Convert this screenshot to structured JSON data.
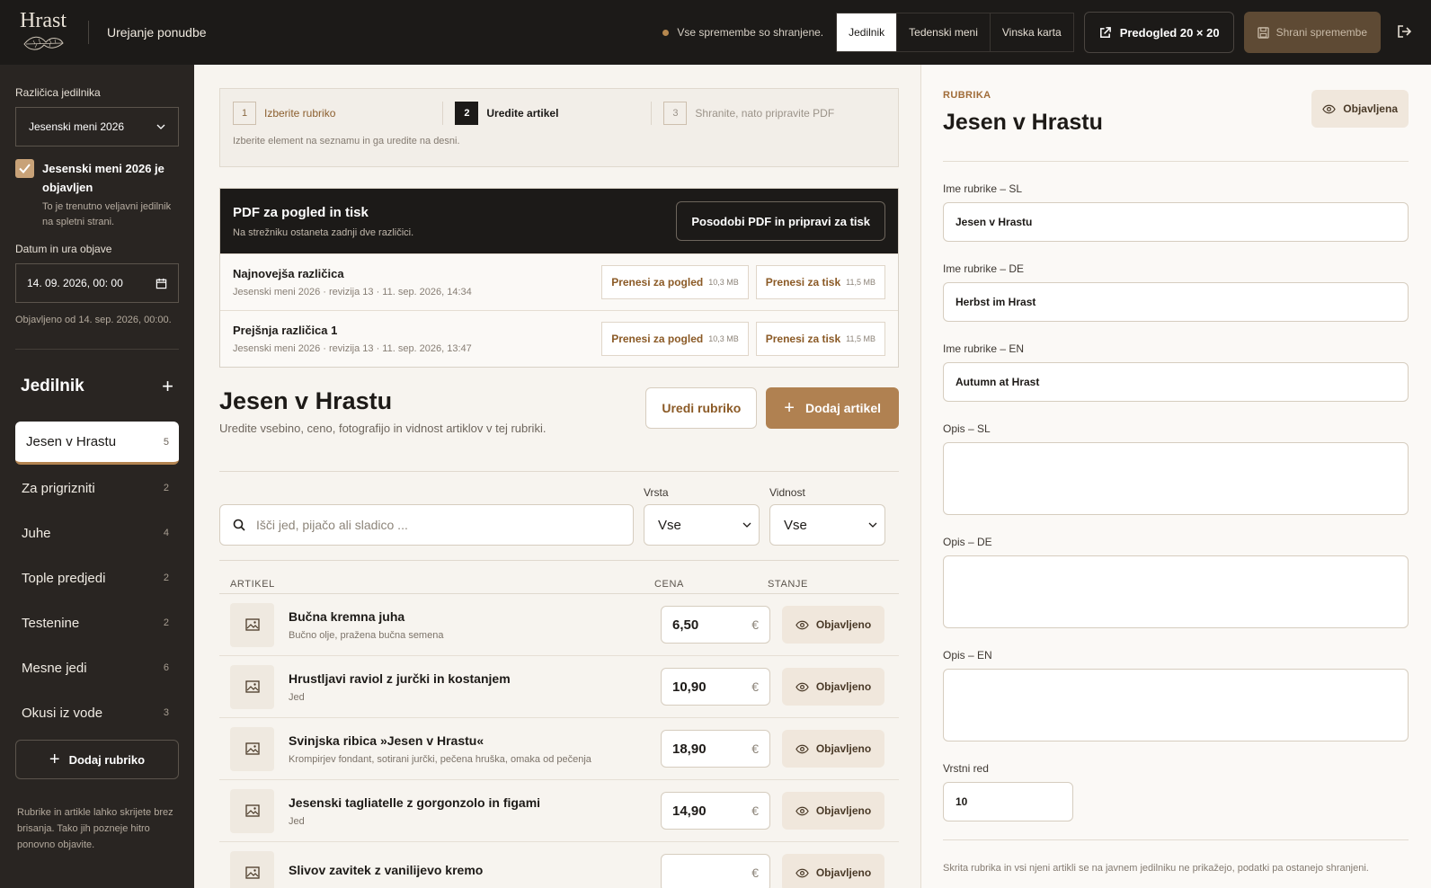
{
  "header": {
    "logo_text": "Hrast",
    "page_name": "Urejanje ponudbe",
    "saved_status": "Vse spremembe so shranjene.",
    "tabs": [
      {
        "label": "Jedilnik"
      },
      {
        "label": "Tedenski meni"
      },
      {
        "label": "Vinska karta"
      }
    ],
    "preview_label": "Predogled 20 × 20",
    "save_label": "Shrani spremembe"
  },
  "sidebar": {
    "version_label": "Različica jedilnika",
    "version_value": "Jesenski meni 2026",
    "published_title": "Jesenski meni 2026 je objavljen",
    "published_note": "To je trenutno veljavni jedilnik na spletni strani.",
    "date_label": "Datum in ura objave",
    "date_value": "14. 09. 2026, 00: 00",
    "published_since": "Objavljeno od 14. sep. 2026, 00:00.",
    "menu_title": "Jedilnik",
    "categories": [
      {
        "name": "Jesen v Hrastu",
        "count": "5"
      },
      {
        "name": "Za prigrizniti",
        "count": "2"
      },
      {
        "name": "Juhe",
        "count": "4"
      },
      {
        "name": "Tople predjedi",
        "count": "2"
      },
      {
        "name": "Testenine",
        "count": "2"
      },
      {
        "name": "Mesne jedi",
        "count": "6"
      },
      {
        "name": "Okusi iz vode",
        "count": "3"
      }
    ],
    "add_category_label": "Dodaj rubriko",
    "footer_note": "Rubrike in artikle lahko skrijete brez brisanja. Tako jih pozneje hitro ponovno objavite."
  },
  "steps": {
    "items": [
      {
        "num": "1",
        "label": "Izberite rubriko"
      },
      {
        "num": "2",
        "label": "Uredite artikel"
      },
      {
        "num": "3",
        "label": "Shranite, nato pripravite PDF"
      }
    ],
    "note": "Izberite element na seznamu in ga uredite na desni."
  },
  "pdf": {
    "title": "PDF za pogled in tisk",
    "subtitle": "Na strežniku ostaneta zadnji dve različici.",
    "update_label": "Posodobi PDF in pripravi za tisk",
    "rows": [
      {
        "title": "Najnovejša različica",
        "meta": "Jesenski meni 2026 · revizija 13 · 11. sep. 2026, 14:34",
        "view_label": "Prenesi za pogled",
        "view_size": "10,3 MB",
        "print_label": "Prenesi za tisk",
        "print_size": "11,5 MB"
      },
      {
        "title": "Prejšnja različica 1",
        "meta": "Jesenski meni 2026 · revizija 13 · 11. sep. 2026, 13:47",
        "view_label": "Prenesi za pogled",
        "view_size": "10,3 MB",
        "print_label": "Prenesi za tisk",
        "print_size": "11,5 MB"
      }
    ]
  },
  "section": {
    "title": "Jesen v Hrastu",
    "subtitle": "Uredite vsebino, ceno, fotografijo in vidnost artiklov v tej rubriki.",
    "edit_label": "Uredi rubriko",
    "add_label": "Dodaj artikel",
    "search_placeholder": "Išči jed, pijačo ali sladico ...",
    "type_label": "Vrsta",
    "type_value": "Vse",
    "visibility_label": "Vidnost",
    "visibility_value": "Vse",
    "col_article": "ARTIKEL",
    "col_price": "CENA",
    "col_status": "STANJE",
    "currency": "€",
    "items": [
      {
        "name": "Bučna kremna juha",
        "desc": "Bučno olje, pražena bučna semena",
        "price": "6,50",
        "status": "Objavljeno"
      },
      {
        "name": "Hrustljavi raviol z jurčki in kostanjem",
        "desc": "Jed",
        "price": "10,90",
        "status": "Objavljeno"
      },
      {
        "name": "Svinjska ribica »Jesen v Hrastu«",
        "desc": "Krompirjev fondant, sotirani jurčki, pečena hruška, omaka od pečenja",
        "price": "18,90",
        "status": "Objavljeno"
      },
      {
        "name": "Jesenski tagliatelle z gorgonzolo in figami",
        "desc": "Jed",
        "price": "14,90",
        "status": "Objavljeno"
      },
      {
        "name": "Slivov zavitek z vanilijevo kremo",
        "desc": "",
        "price": "",
        "status": "Objavljeno"
      }
    ]
  },
  "panel": {
    "kicker": "RUBRIKA",
    "title": "Jesen v Hrastu",
    "published_label": "Objavljena",
    "name_sl_label": "Ime rubrike – SL",
    "name_sl": "Jesen v Hrastu",
    "name_de_label": "Ime rubrike – DE",
    "name_de": "Herbst im Hrast",
    "name_en_label": "Ime rubrike – EN",
    "name_en": "Autumn at Hrast",
    "desc_sl_label": "Opis – SL",
    "desc_de_label": "Opis – DE",
    "desc_en_label": "Opis – EN",
    "order_label": "Vrstni red",
    "order_value": "10",
    "footer_note": "Skrita rubrika in vsi njeni artikli se na javnem jedilniku ne prikažejo, podatki pa ostanejo shranjeni."
  },
  "colors": {
    "accent": "#b08151",
    "dark": "#1c1a18",
    "sidebar": "#292522"
  }
}
